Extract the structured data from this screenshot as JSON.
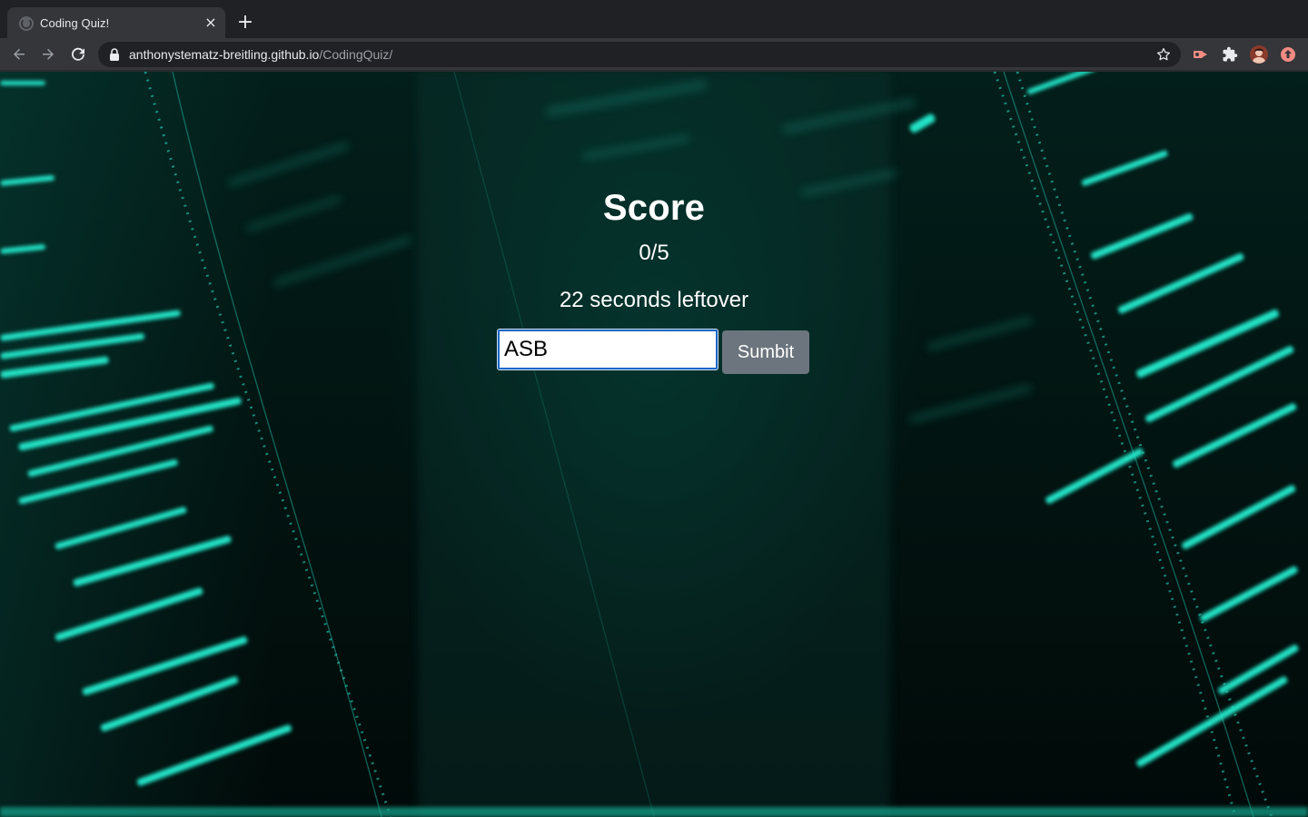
{
  "browser": {
    "tab_title": "Coding Quiz!",
    "tab_close_glyph": "×",
    "new_tab_glyph": "+",
    "url_host": "anthonystematz-breitling.github.io",
    "url_path": "/CodingQuiz/"
  },
  "icons": {
    "back": "back-arrow-icon",
    "forward": "forward-arrow-icon",
    "reload": "reload-icon",
    "lock": "lock-icon",
    "bookmark": "star-icon",
    "extensions": "puzzle-icon",
    "profile": "avatar",
    "update": "update-arrow-icon"
  },
  "page": {
    "score_heading": "Score",
    "score_value": "0/5",
    "time_left": "22 seconds leftover",
    "initials_value": "ASB",
    "submit_label": "Sumbit"
  },
  "colors": {
    "background_accent": "#1ee8c8",
    "submit_button": "#6c757d",
    "input_focus": "#1a66c4"
  }
}
